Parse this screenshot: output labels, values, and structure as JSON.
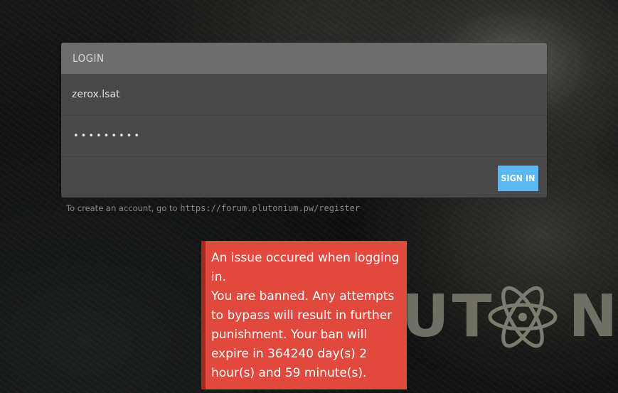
{
  "login": {
    "header": "LOGIN",
    "username": "zerox.lsat",
    "password_mask": "•••••••••",
    "signin_label": "SIGN IN"
  },
  "register_hint": {
    "prefix": "To create an account, go to ",
    "url": "https://forum.plutonium.pw/register"
  },
  "error": {
    "message": "An issue occured when logging in.\nYou are banned. Any attempts to bypass will result in further punishment. Your ban will expire in 364240 day(s) 2 hour(s) and 59 minute(s)."
  },
  "logo": {
    "left_text": "UT",
    "right_text": "N",
    "icon": "atom-icon"
  },
  "colors": {
    "accent": "#5bb8f0",
    "error_bg": "#e2493e",
    "error_border": "#b3241f",
    "panel_bg": "#484848",
    "panel_header": "#6d6d6d"
  }
}
